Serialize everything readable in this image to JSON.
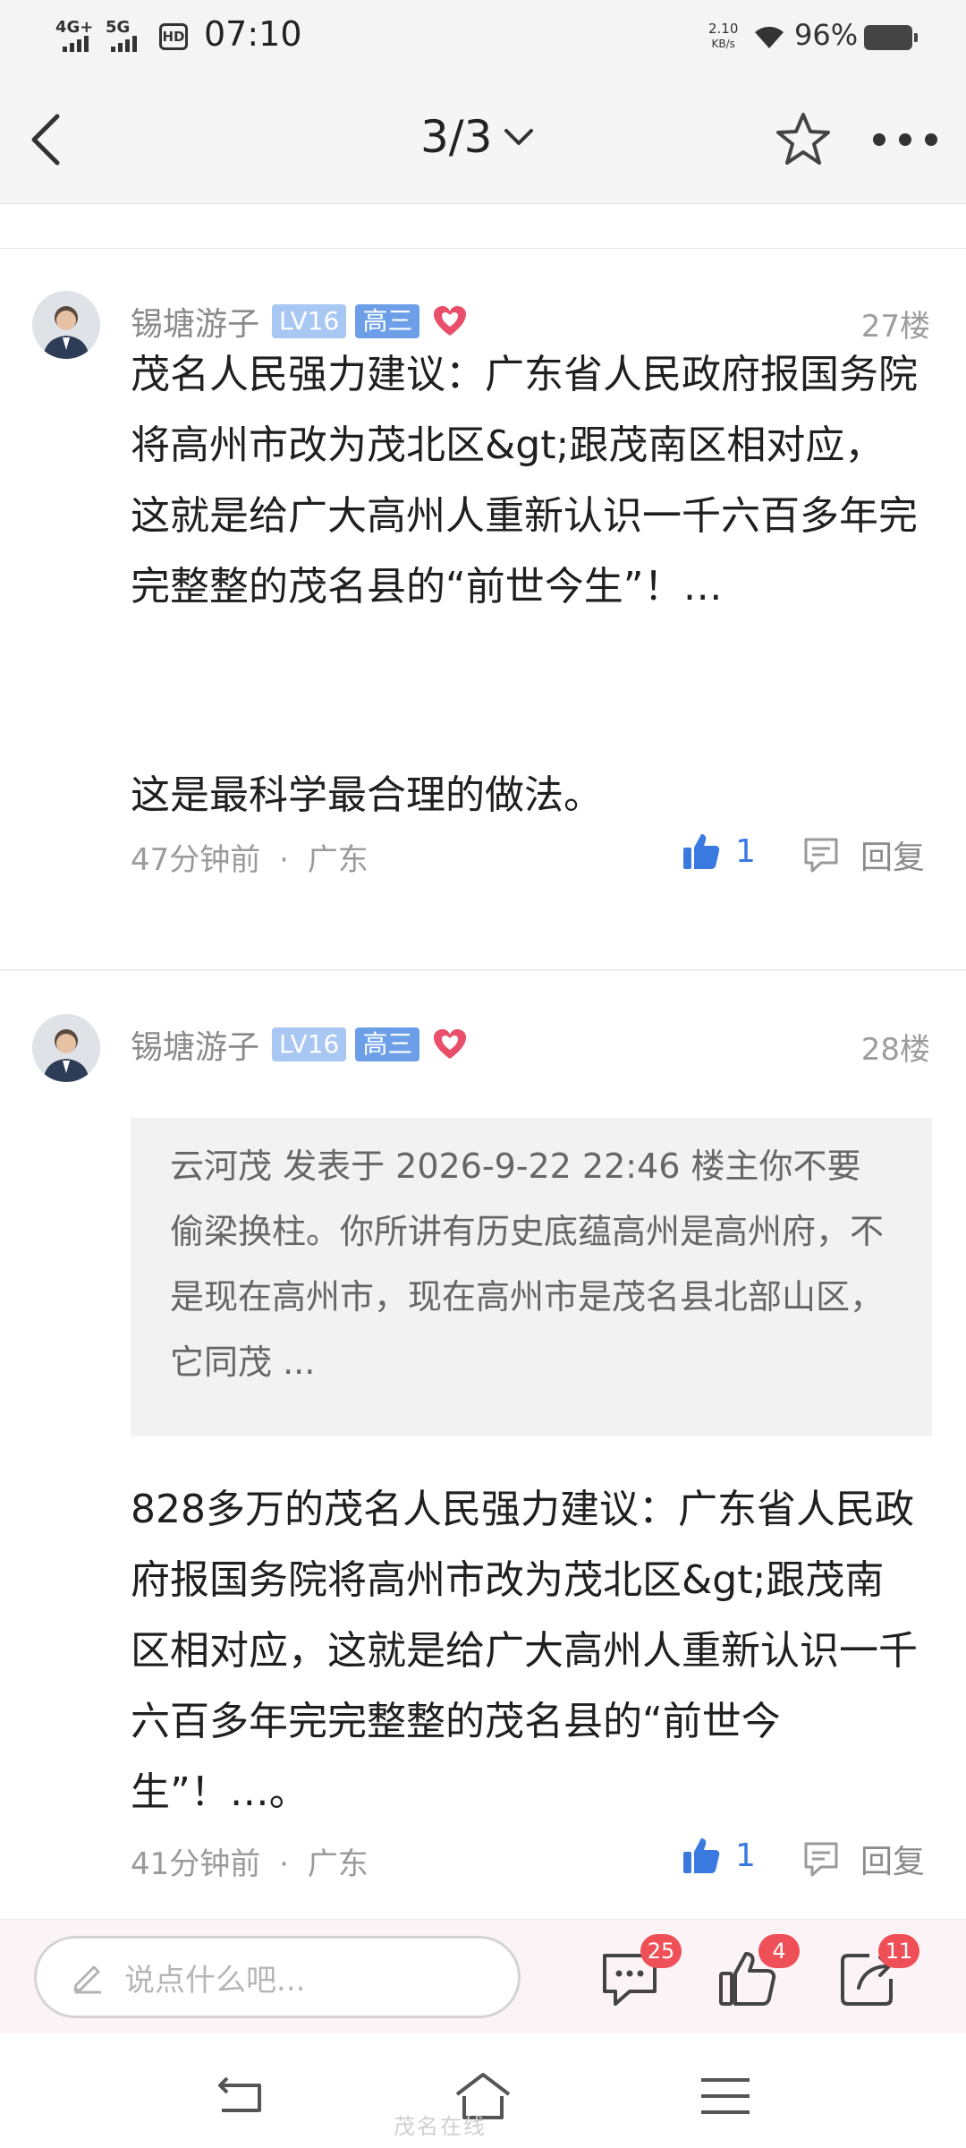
{
  "status_bar": {
    "network_1": "4G+",
    "network_2": "5G",
    "hd_label": "HD",
    "time": "07:10",
    "speed_value": "2.10",
    "speed_unit": "KB/s",
    "battery": "96%"
  },
  "header": {
    "page_indicator": "3/3",
    "back_icon": "back-arrow-icon",
    "favorite_icon": "star-icon",
    "more_icon": "more-dots-icon"
  },
  "posts": [
    {
      "author": "锡塘游子",
      "level_badge": "LV16",
      "grade_badge": "高三",
      "floor": "27楼",
      "body_main": "茂名人民强力建议：广东省人民政府报国务院将高州市改为茂北区&gt;跟茂南区相对应，这就是给广大高州人重新认识一千六百多年完完整整的茂名县的“前世今生”！…",
      "body_extra": "这是最科学最合理的做法。",
      "time": "47分钟前",
      "separator": "·",
      "location": "广东",
      "likes": "1",
      "reply_label": "回复"
    },
    {
      "author": "锡塘游子",
      "level_badge": "LV16",
      "grade_badge": "高三",
      "floor": "28楼",
      "quote": "云河茂 发表于 2026-9-22 22:46 楼主你不要偷梁换柱。你所讲有历史底蕴高州是高州府，不是现在高州市，现在高州市是茂名县北部山区，它同茂 ...",
      "body_main": "828多万的茂名人民强力建议：广东省人民政府报国务院将高州市改为茂北区&gt;跟茂南区相对应，这就是给广大高州人重新认识一千六百多年完完整整的茂名县的“前世今生”！…。",
      "time": "41分钟前",
      "separator": "·",
      "location": "广东",
      "likes": "1",
      "reply_label": "回复"
    }
  ],
  "bottom_bar": {
    "input_placeholder": "说点什么吧...",
    "comments_count": "25",
    "likes_count": "4",
    "shares_count": "11"
  },
  "system_nav": {
    "watermark": "茂名在线"
  },
  "colors": {
    "accent_blue": "#3a7ae0",
    "badge_red": "#ef4f57",
    "heart_red": "#e94e6a",
    "level_badge_bg": "#a9c7f3",
    "grade_badge_bg": "#6d9fe8"
  }
}
